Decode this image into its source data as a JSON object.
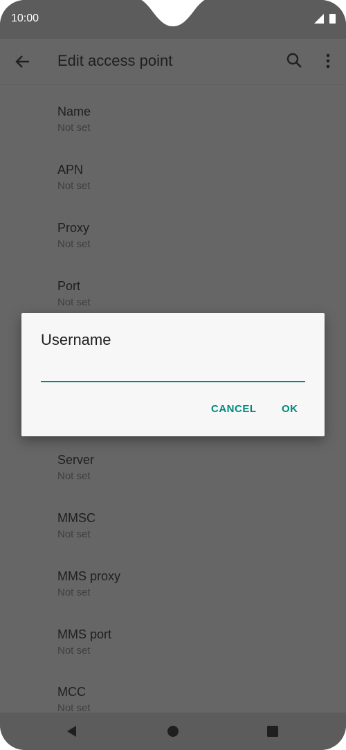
{
  "status_bar": {
    "time": "10:00"
  },
  "app_bar": {
    "title": "Edit access point"
  },
  "preferences": [
    {
      "title": "Name",
      "summary": "Not set"
    },
    {
      "title": "APN",
      "summary": "Not set"
    },
    {
      "title": "Proxy",
      "summary": "Not set"
    },
    {
      "title": "Port",
      "summary": "Not set"
    },
    {
      "title": "Server",
      "summary": "Not set"
    },
    {
      "title": "MMSC",
      "summary": "Not set"
    },
    {
      "title": "MMS proxy",
      "summary": "Not set"
    },
    {
      "title": "MMS port",
      "summary": "Not set"
    },
    {
      "title": "MCC",
      "summary": "Not set"
    }
  ],
  "dialog": {
    "title": "Username",
    "input_value": "",
    "cancel_label": "CANCEL",
    "ok_label": "OK"
  },
  "colors": {
    "scrim_background": "#666666",
    "dialog_background": "#f7f7f7",
    "accent": "#00897b"
  },
  "icons": {
    "back": "arrow-left-icon",
    "search": "search-icon",
    "more": "more-vert-icon",
    "nav_back": "triangle-back-icon",
    "nav_home": "circle-home-icon",
    "nav_recents": "square-recents-icon"
  }
}
